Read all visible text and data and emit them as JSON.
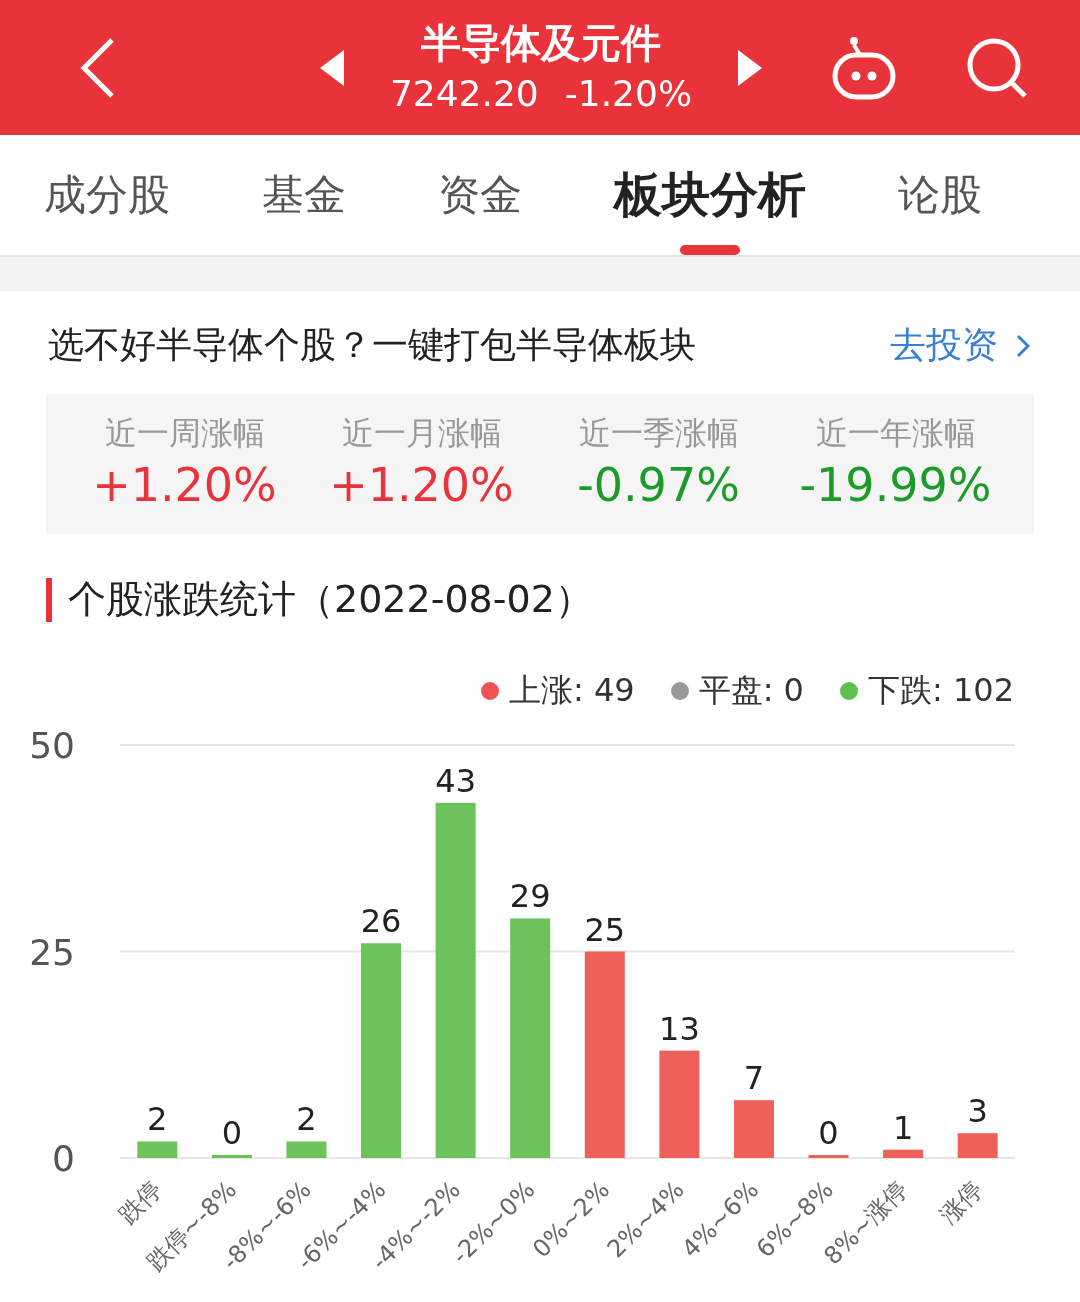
{
  "header": {
    "title": "半导体及元件",
    "price": "7242.20",
    "change": "-1.20%"
  },
  "tabs": [
    {
      "label": "成分股",
      "selected": false
    },
    {
      "label": "基金",
      "selected": false
    },
    {
      "label": "资金",
      "selected": false
    },
    {
      "label": "板块分析",
      "selected": true
    },
    {
      "label": "论股",
      "selected": false
    }
  ],
  "promo": {
    "text": "选不好半导体个股？一键打包半导体板块",
    "link": "去投资"
  },
  "stats": [
    {
      "label": "近一周涨幅",
      "value": "+1.20%",
      "kind": "up"
    },
    {
      "label": "近一月涨幅",
      "value": "+1.20%",
      "kind": "up"
    },
    {
      "label": "近一季涨幅",
      "value": "-0.97%",
      "kind": "down"
    },
    {
      "label": "近一年涨幅",
      "value": "-19.99%",
      "kind": "down"
    }
  ],
  "section_title": "个股涨跌统计（2022-08-02）",
  "legend": [
    {
      "label": "上涨: 49",
      "color": "#ef5350"
    },
    {
      "label": "平盘: 0",
      "color": "#999999"
    },
    {
      "label": "下跌: 102",
      "color": "#5cc14c"
    }
  ],
  "chart_data": {
    "type": "bar",
    "categories": [
      "跌停",
      "跌停~-8%",
      "-8%~-6%",
      "-6%~-4%",
      "-4%~-2%",
      "-2%~0%",
      "0%~2%",
      "2%~4%",
      "4%~6%",
      "6%~8%",
      "8%~涨停",
      "涨停"
    ],
    "series": [
      {
        "color": "#6cc35a",
        "values": [
          2,
          0,
          2,
          26,
          43,
          29,
          null,
          null,
          null,
          null,
          null,
          null
        ]
      },
      {
        "color": "#f0605a",
        "values": [
          null,
          null,
          null,
          null,
          null,
          null,
          25,
          13,
          7,
          0,
          1,
          3
        ]
      }
    ],
    "ylim": [
      0,
      50
    ],
    "yticks": [
      0,
      25,
      50
    ],
    "data_labels": true
  }
}
